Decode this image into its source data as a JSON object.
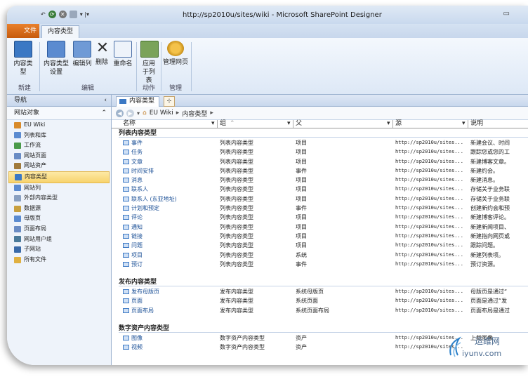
{
  "window": {
    "title": "http://sp2010u/sites/wiki - Microsoft SharePoint Designer"
  },
  "ribbon": {
    "file_tab": "文件",
    "active_tab": "内容类型",
    "buttons": [
      {
        "id": "content-type",
        "label": "内容类型"
      },
      {
        "id": "content-type-settings",
        "label": "内容类型设置"
      },
      {
        "id": "edit-columns",
        "label": "编辑列"
      },
      {
        "id": "delete",
        "label": "删除"
      },
      {
        "id": "rename",
        "label": "重命名"
      },
      {
        "id": "apply-to-list",
        "label": "应用于列表"
      },
      {
        "id": "manage-web",
        "label": "管理网页"
      }
    ],
    "groups": {
      "new": "新建",
      "edit": "编辑",
      "actions": "动作",
      "manage": "管理"
    }
  },
  "nav": {
    "header": "导航",
    "section": "网站对象",
    "items": [
      {
        "label": "EU Wiki",
        "color": "#d88a2a"
      },
      {
        "label": "列表和库",
        "color": "#5b8bd0"
      },
      {
        "label": "工作流",
        "color": "#4a9a4a"
      },
      {
        "label": "网站页面",
        "color": "#6a8cc4"
      },
      {
        "label": "网站资产",
        "color": "#a07a3c"
      },
      {
        "label": "内容类型",
        "color": "#3b78c4",
        "selected": true
      },
      {
        "label": "网站列",
        "color": "#5b8bd0"
      },
      {
        "label": "外部内容类型",
        "color": "#8aa0c0"
      },
      {
        "label": "数据源",
        "color": "#c8a040"
      },
      {
        "label": "母版页",
        "color": "#5b8bd0"
      },
      {
        "label": "页面布局",
        "color": "#6a8cc4"
      },
      {
        "label": "网站用户组",
        "color": "#4a7a9a"
      },
      {
        "label": "子网站",
        "color": "#3a6aa8"
      },
      {
        "label": "所有文件",
        "color": "#e0b040"
      }
    ]
  },
  "doc_tab": {
    "label": "内容类型"
  },
  "breadcrumb": {
    "site": "EU Wiki",
    "page": "内容类型"
  },
  "columns": {
    "name": "名称",
    "group": "组",
    "parent": "父",
    "source": "源",
    "description": "说明"
  },
  "groups": [
    {
      "title": "列表内容类型",
      "rows": [
        {
          "name": "事件",
          "group": "列表内容类型",
          "parent": "项目",
          "source": "http://sp2010u/sites...",
          "desc": "新建会议、时间"
        },
        {
          "name": "任务",
          "group": "列表内容类型",
          "parent": "项目",
          "source": "http://sp2010u/sites...",
          "desc": "跟踪您或您的工"
        },
        {
          "name": "文章",
          "group": "列表内容类型",
          "parent": "项目",
          "source": "http://sp2010u/sites...",
          "desc": "新建博客文章。"
        },
        {
          "name": "时间安排",
          "group": "列表内容类型",
          "parent": "事件",
          "source": "http://sp2010u/sites...",
          "desc": "新建约会。"
        },
        {
          "name": "消息",
          "group": "列表内容类型",
          "parent": "项目",
          "source": "http://sp2010u/sites...",
          "desc": "新建消息。"
        },
        {
          "name": "联系人",
          "group": "列表内容类型",
          "parent": "项目",
          "source": "http://sp2010u/sites...",
          "desc": "存储关于业务联"
        },
        {
          "name": "联系人 (东亚地址)",
          "group": "列表内容类型",
          "parent": "项目",
          "source": "http://sp2010u/sites...",
          "desc": "存储关于业务联"
        },
        {
          "name": "计划和预定",
          "group": "列表内容类型",
          "parent": "事件",
          "source": "http://sp2010u/sites...",
          "desc": "创建新约会和预"
        },
        {
          "name": "评论",
          "group": "列表内容类型",
          "parent": "项目",
          "source": "http://sp2010u/sites...",
          "desc": "新建博客评论。"
        },
        {
          "name": "通知",
          "group": "列表内容类型",
          "parent": "项目",
          "source": "http://sp2010u/sites...",
          "desc": "新建新闻项目、"
        },
        {
          "name": "链接",
          "group": "列表内容类型",
          "parent": "项目",
          "source": "http://sp2010u/sites...",
          "desc": "新建指向网页或"
        },
        {
          "name": "问题",
          "group": "列表内容类型",
          "parent": "项目",
          "source": "http://sp2010u/sites...",
          "desc": "跟踪问题。"
        },
        {
          "name": "项目",
          "group": "列表内容类型",
          "parent": "系统",
          "source": "http://sp2010u/sites...",
          "desc": "新建列表项。"
        },
        {
          "name": "预订",
          "group": "列表内容类型",
          "parent": "事件",
          "source": "http://sp2010u/sites...",
          "desc": "预订资源。"
        }
      ]
    },
    {
      "title": "发布内容类型",
      "rows": [
        {
          "name": "发布母版页",
          "group": "发布内容类型",
          "parent": "系统母版页",
          "source": "http://sp2010u/sites...",
          "desc": "母版页是通过“"
        },
        {
          "name": "页面",
          "group": "发布内容类型",
          "parent": "系统页面",
          "source": "http://sp2010u/sites...",
          "desc": "页面是通过“发"
        },
        {
          "name": "页面布局",
          "group": "发布内容类型",
          "parent": "系统页面布局",
          "source": "http://sp2010u/sites...",
          "desc": "页面布局是通过"
        }
      ]
    },
    {
      "title": "数字资产内容类型",
      "rows": [
        {
          "name": "图像",
          "group": "数字资产内容类型",
          "parent": "资产",
          "source": "http://sp2010u/sites...",
          "desc": "上载图像"
        },
        {
          "name": "视频",
          "group": "数字资产内容类型",
          "parent": "资产",
          "source": "http://sp2010u/sites...",
          "desc": ""
        }
      ]
    }
  ],
  "watermark": {
    "brand": "运维网",
    "url": "iyunv.com"
  }
}
